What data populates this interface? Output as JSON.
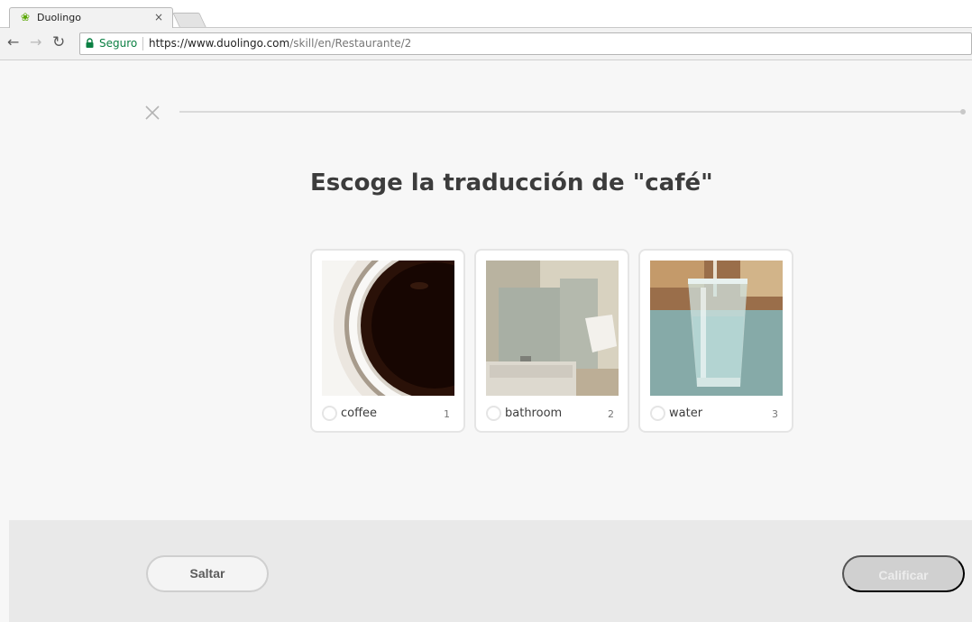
{
  "browser": {
    "tab_title": "Duolingo",
    "tab_close": "×",
    "tab_icon": "duolingo-owl-icon",
    "secure_label": "Seguro",
    "url_host": "https://www.duolingo.com",
    "url_path": "/skill/en/Restaurante/2"
  },
  "lesson": {
    "prompt": "Escoge la traducción de \"café\"",
    "progress": 0,
    "choices": [
      {
        "word": "coffee",
        "number": "1",
        "image": "coffee-cup-image"
      },
      {
        "word": "bathroom",
        "number": "2",
        "image": "bathroom-image"
      },
      {
        "word": "water",
        "number": "3",
        "image": "water-glass-image"
      }
    ]
  },
  "footer": {
    "skip_label": "Saltar",
    "check_label": "Calificar"
  },
  "colors": {
    "page_background": "#f7f7f7",
    "footer_background": "#e9e9e9",
    "disabled_button": "#d0d0d0",
    "secure_green": "#0b8043"
  }
}
